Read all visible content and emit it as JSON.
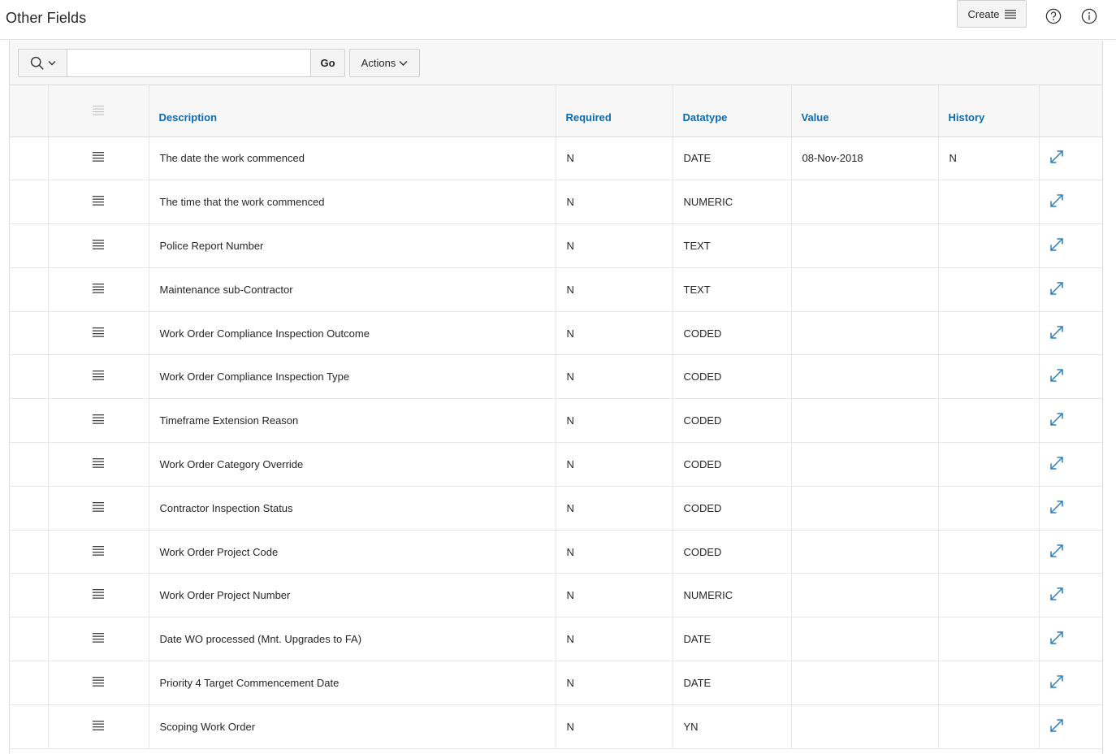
{
  "header": {
    "title": "Other Fields",
    "create_label": "Create",
    "icons": {
      "help": "help-circle-icon",
      "info": "info-circle-icon",
      "menu": "hamburger-menu-icon"
    }
  },
  "toolbar": {
    "search_placeholder": "",
    "search_value": "",
    "go_label": "Go",
    "actions_label": "Actions"
  },
  "table": {
    "columns": {
      "description": "Description",
      "required": "Required",
      "datatype": "Datatype",
      "value": "Value",
      "history": "History"
    },
    "rows": [
      {
        "description": "The date the work commenced",
        "required": "N",
        "datatype": "DATE",
        "value": "08-Nov-2018",
        "history": "N"
      },
      {
        "description": "The time that the work commenced",
        "required": "N",
        "datatype": "NUMERIC",
        "value": "",
        "history": ""
      },
      {
        "description": "Police Report Number",
        "required": "N",
        "datatype": "TEXT",
        "value": "",
        "history": ""
      },
      {
        "description": "Maintenance sub-Contractor",
        "required": "N",
        "datatype": "TEXT",
        "value": "",
        "history": ""
      },
      {
        "description": "Work Order Compliance Inspection Outcome",
        "required": "N",
        "datatype": "CODED",
        "value": "",
        "history": ""
      },
      {
        "description": "Work Order Compliance Inspection Type",
        "required": "N",
        "datatype": "CODED",
        "value": "",
        "history": ""
      },
      {
        "description": "Timeframe Extension Reason",
        "required": "N",
        "datatype": "CODED",
        "value": "",
        "history": ""
      },
      {
        "description": "Work Order Category Override",
        "required": "N",
        "datatype": "CODED",
        "value": "",
        "history": ""
      },
      {
        "description": "Contractor Inspection Status",
        "required": "N",
        "datatype": "CODED",
        "value": "",
        "history": ""
      },
      {
        "description": "Work Order Project Code",
        "required": "N",
        "datatype": "CODED",
        "value": "",
        "history": ""
      },
      {
        "description": "Work Order Project Number",
        "required": "N",
        "datatype": "NUMERIC",
        "value": "",
        "history": ""
      },
      {
        "description": "Date WO processed (Mnt. Upgrades to FA)",
        "required": "N",
        "datatype": "DATE",
        "value": "",
        "history": ""
      },
      {
        "description": "Priority 4 Target Commencement Date",
        "required": "N",
        "datatype": "DATE",
        "value": "",
        "history": ""
      },
      {
        "description": "Scoping Work Order",
        "required": "N",
        "datatype": "YN",
        "value": "",
        "history": ""
      }
    ]
  },
  "colors": {
    "link": "#0b6ab0",
    "icon_blue": "#2a7fc1",
    "text": "#262626",
    "border": "#e6e6e6"
  }
}
